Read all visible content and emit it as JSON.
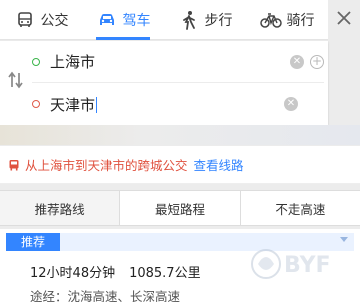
{
  "modes": [
    {
      "label": "公交",
      "icon": "bus-icon",
      "active": false
    },
    {
      "label": "驾车",
      "icon": "car-icon",
      "active": true
    },
    {
      "label": "步行",
      "icon": "walk-icon",
      "active": false
    },
    {
      "label": "骑行",
      "icon": "bike-icon",
      "active": false
    }
  ],
  "route": {
    "origin": "上海市",
    "destination": "天津市"
  },
  "notice": {
    "message": "从上海市到天津市的跨城公交",
    "link": "查看线路"
  },
  "route_tabs": [
    {
      "label": "推荐路线",
      "active": true
    },
    {
      "label": "最短路程",
      "active": false
    },
    {
      "label": "不走高速",
      "active": false
    }
  ],
  "result": {
    "badge": "推荐",
    "duration": "12小时48分钟",
    "distance": "1085.7公里",
    "via": "途经：沈海高速、长深高速"
  },
  "watermark": "BYF",
  "colors": {
    "accent": "#3385ff",
    "notice": "#e0523f",
    "origin_dot": "#3ab54a",
    "destination_dot": "#e05a4a"
  }
}
